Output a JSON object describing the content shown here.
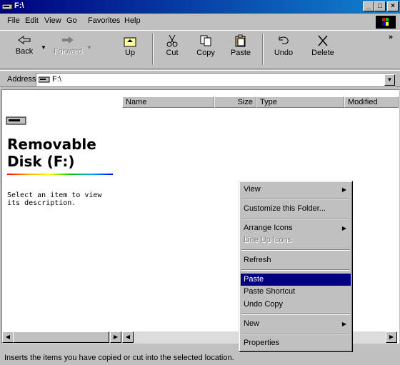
{
  "window": {
    "title": "F:\\"
  },
  "menubar": [
    "File",
    "Edit",
    "View",
    "Go",
    "Favorites",
    "Help"
  ],
  "toolbar": {
    "back": "Back",
    "forward": "Forward",
    "up": "Up",
    "cut": "Cut",
    "copy": "Copy",
    "paste": "Paste",
    "undo": "Undo",
    "delete": "Delete",
    "more": "»"
  },
  "address": {
    "label": "Address",
    "value": "F:\\"
  },
  "columns": {
    "name": "Name",
    "size": "Size",
    "type": "Type",
    "modified": "Modified"
  },
  "webview": {
    "title": "Removable Disk (F:)",
    "description": "Select an item to view its description."
  },
  "context_menu": {
    "view": "View",
    "customize": "Customize this Folder...",
    "arrange": "Arrange Icons",
    "lineup": "Line Up Icons",
    "refresh": "Refresh",
    "paste": "Paste",
    "paste_shortcut": "Paste Shortcut",
    "undo_copy": "Undo Copy",
    "new": "New",
    "properties": "Properties"
  },
  "status": {
    "text": "Inserts the items you have copied or cut into the selected location."
  },
  "colors": {
    "title_start": "#000080",
    "title_end": "#1084d0",
    "selection": "#000080",
    "face": "#c0c0c0"
  }
}
